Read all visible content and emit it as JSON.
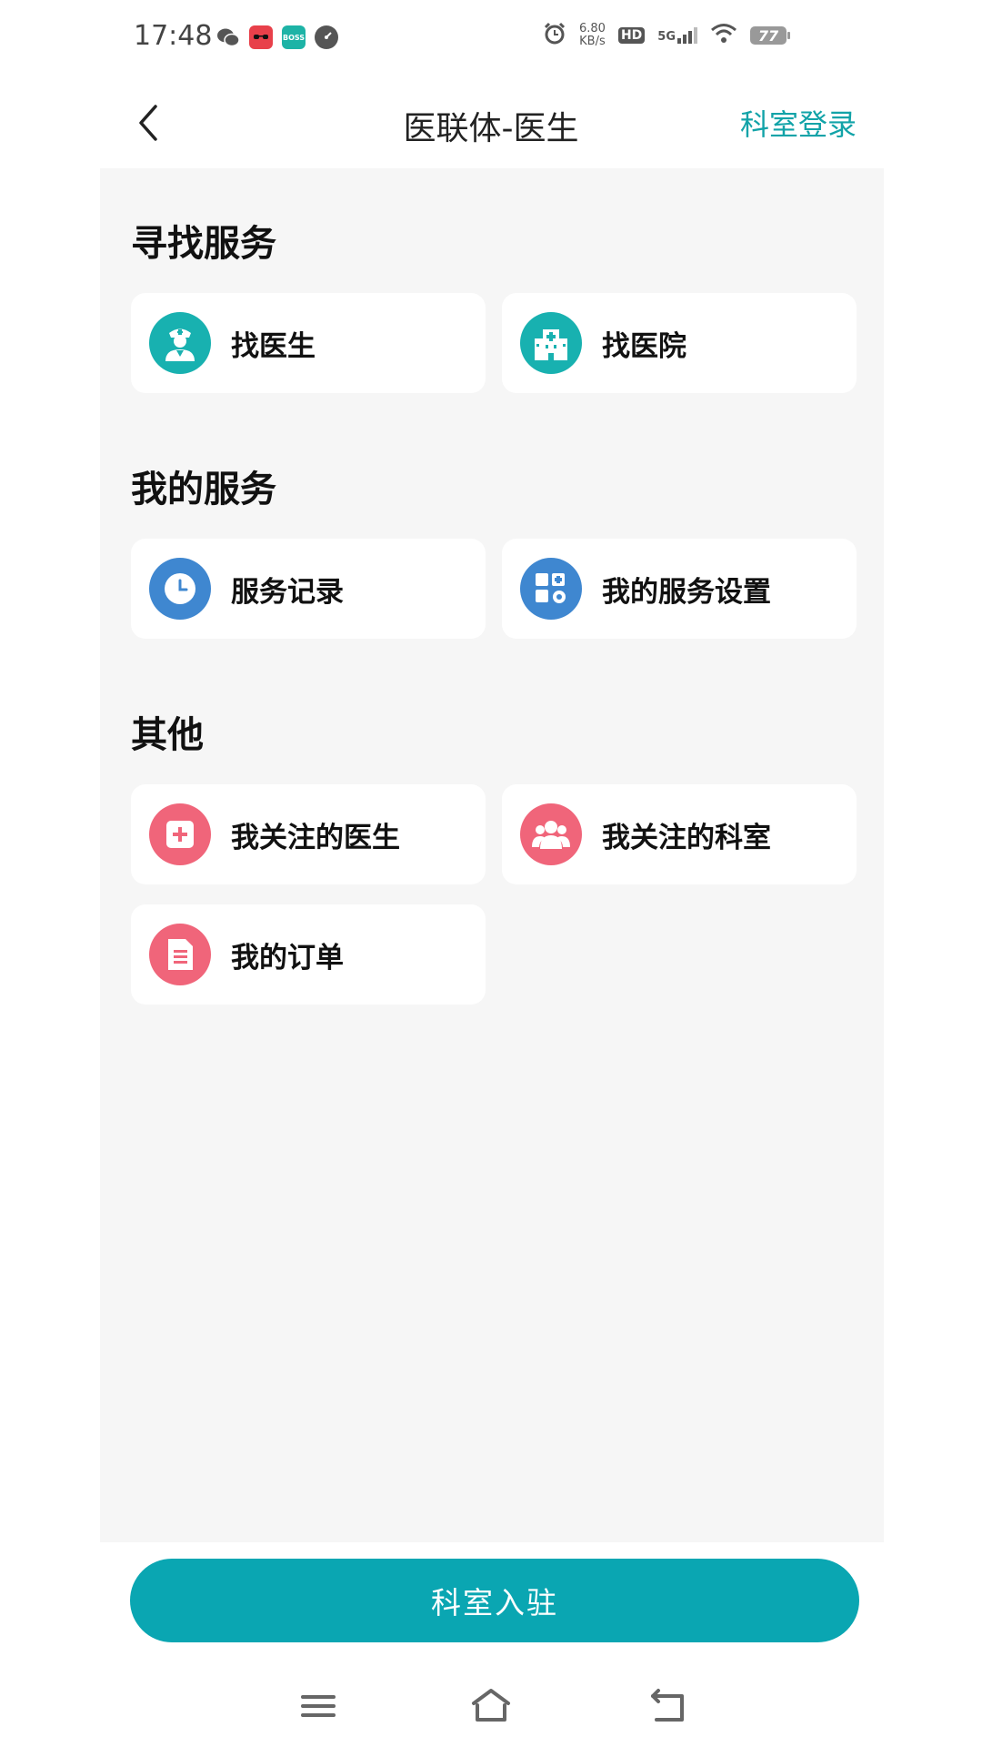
{
  "status_bar": {
    "time": "17:48",
    "app_icons": [
      "wechat-icon",
      "red-app-icon",
      "boss-app-icon",
      "gauge-app-icon"
    ],
    "red_app_text": "",
    "boss_app_text": "BOSS",
    "net_speed_value": "6.80",
    "net_speed_unit": "KB/s",
    "hd_label": "HD",
    "network_label": "5G",
    "battery": "77"
  },
  "header": {
    "title": "医联体-医生",
    "right_action": "科室登录",
    "back_icon": "chevron-left-icon"
  },
  "sections": [
    {
      "title": "寻找服务",
      "items": [
        {
          "label": "找医生",
          "icon": "doctor-icon",
          "color": "#18b1b0"
        },
        {
          "label": "找医院",
          "icon": "hospital-icon",
          "color": "#18b1b0"
        }
      ]
    },
    {
      "title": "我的服务",
      "items": [
        {
          "label": "服务记录",
          "icon": "clock-icon",
          "color": "#3f87d0"
        },
        {
          "label": "我的服务设置",
          "icon": "grid-settings-icon",
          "color": "#3f87d0"
        }
      ]
    },
    {
      "title": "其他",
      "items": [
        {
          "label": "我关注的医生",
          "icon": "medical-plus-icon",
          "color": "#f0657a"
        },
        {
          "label": "我关注的科室",
          "icon": "group-icon",
          "color": "#f0657a"
        },
        {
          "label": "我的订单",
          "icon": "document-icon",
          "color": "#f0657a"
        }
      ]
    }
  ],
  "bottom_button": {
    "label": "科室入驻",
    "color": "#0aa6b2"
  },
  "nav_bar": {
    "icons": [
      "menu-icon",
      "home-icon",
      "back-icon"
    ]
  },
  "colors": {
    "accent": "#12a3a8",
    "teal": "#18b1b0",
    "blue": "#3f87d0",
    "pink": "#f0657a",
    "background": "#f6f6f6"
  }
}
